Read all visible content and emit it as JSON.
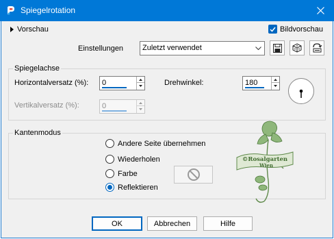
{
  "window": {
    "title": "Spiegelrotation",
    "accent": "#0078d7",
    "icon": "psp-app-icon"
  },
  "header": {
    "preview_label": "Vorschau",
    "bildvorschau_label": "Bildvorschau",
    "bildvorschau_checked": true
  },
  "settings": {
    "label": "Einstellungen",
    "preset_value": "Zuletzt verwendet",
    "tools": [
      "save-icon",
      "randomize-icon",
      "reset-icon"
    ]
  },
  "spiegelachse": {
    "title": "Spiegelachse",
    "horizontal_label": "Horizontalversatz (%):",
    "horizontal_value": "0",
    "vertical_label": "Vertikalversatz (%):",
    "vertical_value": "0",
    "rotation_label": "Drehwinkel:",
    "rotation_value": "180"
  },
  "kantenmodus": {
    "title": "Kantenmodus",
    "options": [
      {
        "label": "Andere Seite übernehmen",
        "selected": false
      },
      {
        "label": "Wiederholen",
        "selected": false
      },
      {
        "label": "Farbe",
        "selected": false
      },
      {
        "label": "Reflektieren",
        "selected": true
      }
    ]
  },
  "watermark": {
    "line1": "©Rosalgarten",
    "line2": "Wien",
    "color": "#6f9a5a"
  },
  "footer": {
    "ok_label": "OK",
    "cancel_label": "Abbrechen",
    "help_label": "Hilfe"
  }
}
